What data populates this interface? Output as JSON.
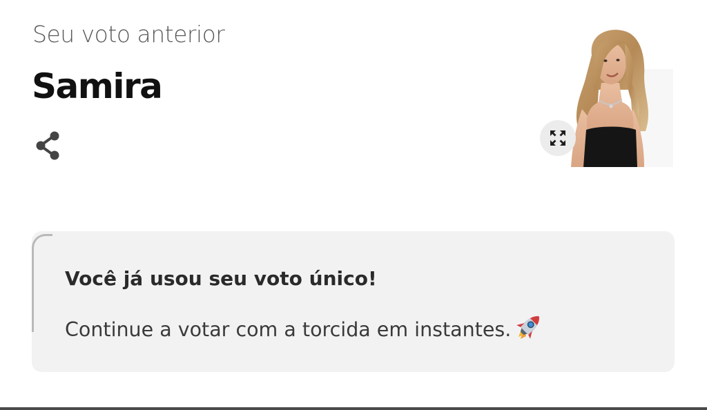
{
  "previous_vote": {
    "label": "Seu voto anterior",
    "candidate_name": "Samira"
  },
  "icons": {
    "share": "share-icon",
    "expand": "expand-icon",
    "rocket": "rocket-emoji-icon"
  },
  "notice": {
    "title": "Você já usou seu voto único!",
    "message": "Continue a votar com a torcida em instantes."
  },
  "colors": {
    "notice_background": "#f2f2f2",
    "notice_accent": "#b9b9b9",
    "text_primary": "#111111",
    "text_muted": "#5a5a5a"
  }
}
